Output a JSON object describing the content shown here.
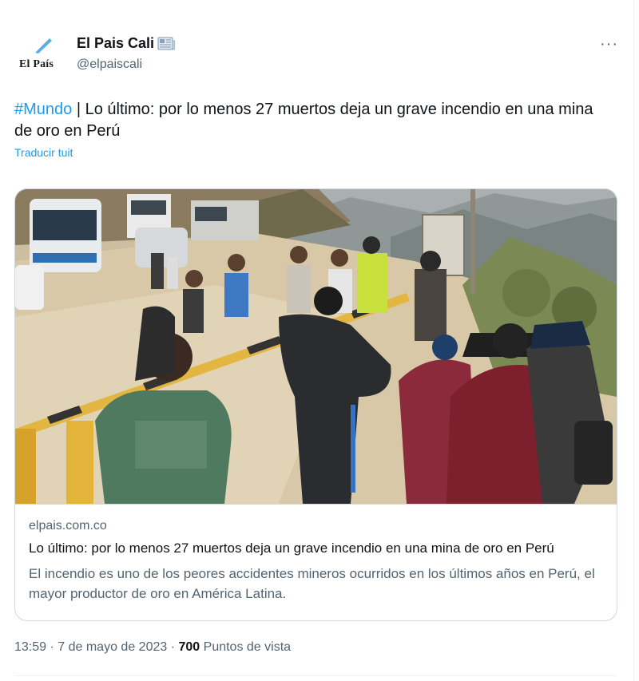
{
  "account": {
    "name": "El Pais Cali",
    "handle": "@elpaiscali",
    "logo_text": "El País"
  },
  "tweet": {
    "hashtag": "#Mundo",
    "text": " | Lo último: por lo menos 27 muertos deja un grave incendio en una mina de oro en Perú",
    "translate_label": "Traducir tuit"
  },
  "card": {
    "domain": "elpais.com.co",
    "title": "Lo último: por lo menos 27 muertos deja un grave incendio en una mina de oro en Perú",
    "description": "El incendio es uno de los peores accidentes mineros ocurridos en los últimos años en Perú, el mayor productor de oro en América Latina."
  },
  "meta": {
    "time": "13:59",
    "separator": " · ",
    "date": "7 de mayo de 2023",
    "views_count": "700",
    "views_label": "Puntos de vista"
  },
  "icons": {
    "more": "more-options-icon",
    "newspaper": "newspaper-icon",
    "logo": "el-pais-logo"
  },
  "colors": {
    "link": "#1d9bf0",
    "secondary_text": "#536471",
    "border": "#cfd9de"
  }
}
